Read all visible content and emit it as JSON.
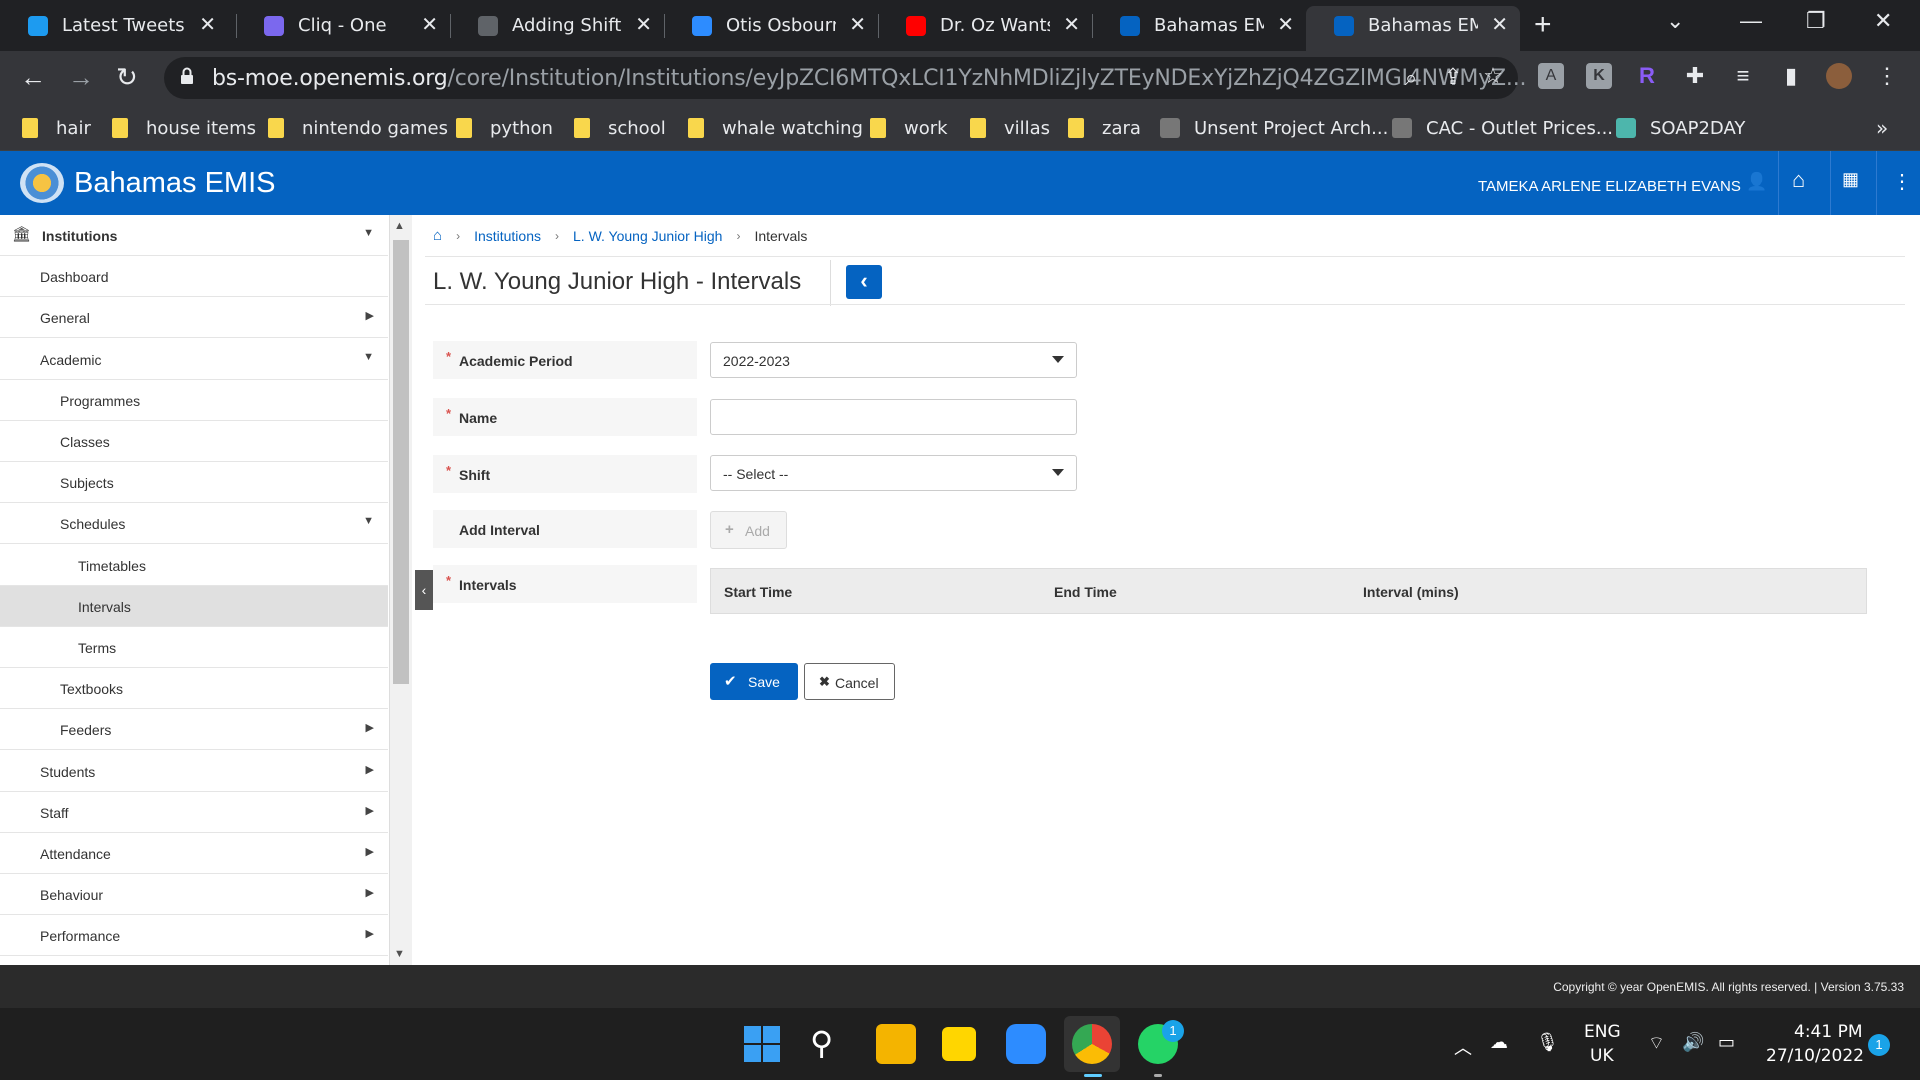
{
  "browser": {
    "tabs": [
      {
        "title": "Latest Tweets /",
        "icon": "twitter-icon"
      },
      {
        "title": "Cliq - One",
        "icon": "cliq-icon"
      },
      {
        "title": "Adding Shifts",
        "icon": "doc-icon"
      },
      {
        "title": "Otis Osbourne",
        "icon": "zoom-icon"
      },
      {
        "title": "Dr. Oz Wants L",
        "icon": "youtube-icon"
      },
      {
        "title": "Bahamas EMIS",
        "icon": "openemis-icon"
      },
      {
        "title": "Bahamas EMIS",
        "icon": "openemis-icon",
        "active": true
      }
    ],
    "url_host": "bs-moe.openemis.org",
    "url_path": "/core/Institution/Institutions/eyJpZCI6MTQxLCI1YzNhMDliZjlyZTEyNDExYjZhZjQ4ZGZlMGI4NWMyZ...",
    "bookmarks": [
      {
        "label": "hair",
        "type": "folder"
      },
      {
        "label": "house items",
        "type": "folder"
      },
      {
        "label": "nintendo games",
        "type": "folder"
      },
      {
        "label": "python",
        "type": "folder"
      },
      {
        "label": "school",
        "type": "folder"
      },
      {
        "label": "whale watching",
        "type": "folder"
      },
      {
        "label": "work",
        "type": "folder"
      },
      {
        "label": "villas",
        "type": "folder"
      },
      {
        "label": "zara",
        "type": "folder"
      },
      {
        "label": "Unsent Project Arch...",
        "type": "site"
      },
      {
        "label": "CAC - Outlet Prices...",
        "type": "site"
      },
      {
        "label": "SOAP2DAY",
        "type": "site"
      }
    ],
    "overflow": "»"
  },
  "app": {
    "name": "Bahamas EMIS",
    "user": "TAMEKA ARLENE ELIZABETH EVANS"
  },
  "sidebar": {
    "items": [
      {
        "label": "Institutions",
        "level": 0,
        "caret": "▼",
        "head": true
      },
      {
        "label": "Dashboard",
        "level": 1,
        "caret": ""
      },
      {
        "label": "General",
        "level": 1,
        "caret": "▶"
      },
      {
        "label": "Academic",
        "level": 1,
        "caret": "▼"
      },
      {
        "label": "Programmes",
        "level": 2,
        "caret": ""
      },
      {
        "label": "Classes",
        "level": 2,
        "caret": ""
      },
      {
        "label": "Subjects",
        "level": 2,
        "caret": ""
      },
      {
        "label": "Schedules",
        "level": 2,
        "caret": "▼"
      },
      {
        "label": "Timetables",
        "level": 3,
        "caret": ""
      },
      {
        "label": "Intervals",
        "level": 3,
        "caret": "",
        "active": true
      },
      {
        "label": "Terms",
        "level": 3,
        "caret": ""
      },
      {
        "label": "Textbooks",
        "level": 2,
        "caret": ""
      },
      {
        "label": "Feeders",
        "level": 2,
        "caret": "▶"
      },
      {
        "label": "Students",
        "level": 1,
        "caret": "▶"
      },
      {
        "label": "Staff",
        "level": 1,
        "caret": "▶"
      },
      {
        "label": "Attendance",
        "level": 1,
        "caret": "▶"
      },
      {
        "label": "Behaviour",
        "level": 1,
        "caret": "▶"
      },
      {
        "label": "Performance",
        "level": 1,
        "caret": "▶"
      }
    ]
  },
  "breadcrumb": {
    "items": [
      "Institutions",
      "L. W. Young Junior High"
    ],
    "current": "Intervals"
  },
  "page": {
    "title": "L. W. Young Junior High - Intervals"
  },
  "form": {
    "academic_period": {
      "label": "Academic Period",
      "value": "2022-2023"
    },
    "name": {
      "label": "Name",
      "value": "",
      "placeholder": ""
    },
    "shift": {
      "label": "Shift",
      "value": "-- Select --"
    },
    "add_interval": {
      "label": "Add Interval",
      "button": "Add"
    },
    "intervals": {
      "label": "Intervals",
      "columns": [
        "Start Time",
        "End Time",
        "Interval (mins)"
      ]
    },
    "required_mark": "*",
    "save": "Save",
    "cancel": "Cancel"
  },
  "footer": {
    "text": "Copyright © year OpenEMIS. All rights reserved. | Version 3.75.33"
  },
  "taskbar": {
    "language": "ENG",
    "region": "UK",
    "time": "4:41 PM",
    "date": "27/10/2022",
    "whatsapp_badge": "1",
    "notification_count": "1"
  },
  "colors": {
    "brand": "#0563c1",
    "required": "#d9534f"
  }
}
